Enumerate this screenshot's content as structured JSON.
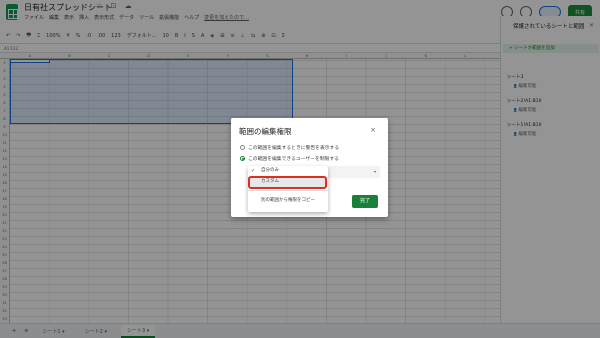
{
  "doc": {
    "title": "日有社スプレッドシート",
    "title_icons": "☆ ⊡ ☁"
  },
  "menu": [
    "ファイル",
    "編集",
    "表示",
    "挿入",
    "表示形式",
    "データ",
    "ツール",
    "拡張機能",
    "ヘルプ"
  ],
  "edit_notice": "変更を加えたので...",
  "share_label": "共有",
  "toolbar": [
    "↶",
    "↷",
    "🖶",
    "⌶",
    "100%",
    "¥",
    "%",
    ".0",
    ".00",
    "123",
    "デフォルト...",
    "10",
    "B",
    "I",
    "S",
    "A",
    "◈",
    "⊞",
    "≡",
    "⊥",
    "⇆",
    "⊕",
    "⊡",
    "Σ"
  ],
  "cell_ref": "A1:F12",
  "columns": [
    "A",
    "B",
    "C",
    "D",
    "E",
    "F",
    "G",
    "H",
    "I",
    "J",
    "K",
    "L"
  ],
  "rows": [
    "1",
    "2",
    "3",
    "4",
    "5",
    "6",
    "7",
    "8",
    "9",
    "10",
    "11",
    "12",
    "13",
    "14",
    "15",
    "16",
    "17",
    "18",
    "19",
    "20",
    "21",
    "22",
    "23",
    "24",
    "25",
    "26",
    "27",
    "28",
    "29",
    "30",
    "31",
    "32",
    "33"
  ],
  "sheets": {
    "add": "+",
    "list": "≡",
    "tabs": [
      "シート1 ▾",
      "シート2 ▾",
      "シート3 ▾"
    ],
    "active_index": 2
  },
  "side_panel": {
    "title": "保護されているシートと範囲",
    "close": "×",
    "add_label": "+ シートか範囲を追加",
    "items": [
      {
        "name": "シート3",
        "sub": "編集可能"
      },
      {
        "name": "シート2!A1:B10",
        "sub": "編集可能"
      },
      {
        "name": "シート1!A1:B10",
        "sub": "編集可能"
      }
    ]
  },
  "dialog": {
    "title": "範囲の編集権限",
    "close": "×",
    "option1": "この範囲を編集するときに警告を表示する",
    "option2": "この範囲を編集できるユーザーを制限する",
    "select_arrow": "▾",
    "dropdown": {
      "check": "✓",
      "items": [
        "自分のみ",
        "カスタム",
        "別の範囲から権限をコピー"
      ]
    },
    "done_label": "完了"
  }
}
